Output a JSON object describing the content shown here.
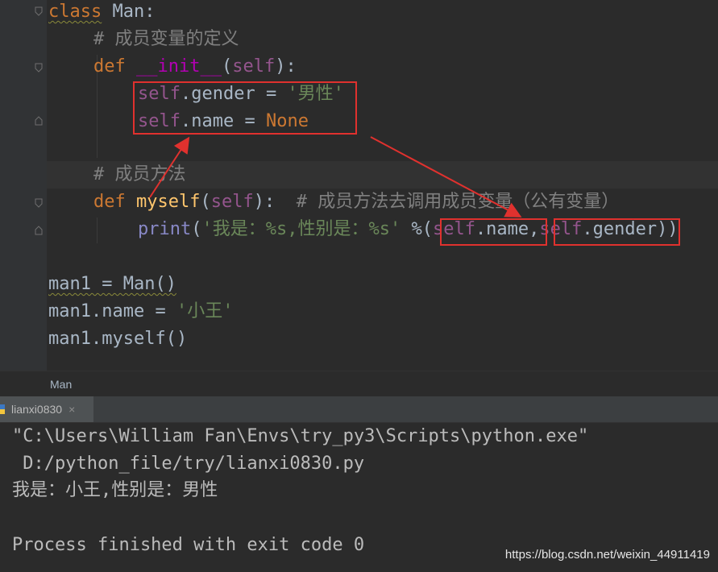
{
  "editor": {
    "lines": {
      "l1": {
        "kw": "class",
        "rest": " Man:"
      },
      "l2": {
        "comment": "# 成员变量的定义"
      },
      "l3": {
        "kw": "def",
        "sp": " ",
        "fn": "__init__",
        "p1": "(",
        "self": "self",
        "p2": "):"
      },
      "l4": {
        "self": "self",
        "rest": ".gender = ",
        "str": "'男性'"
      },
      "l5": {
        "self": "self",
        "rest": ".name = ",
        "kw": "None"
      },
      "l6": {
        "comment": "# 成员方法"
      },
      "l7": {
        "kw": "def",
        "sp": " ",
        "fn": "myself",
        "p1": "(",
        "self": "self",
        "p2": "):",
        "gap": "  ",
        "comment": "# 成员方法去调用成员变量（公有变量）"
      },
      "l8": {
        "fn": "print",
        "p1": "(",
        "str": "'我是：%s,性别是：%s'",
        "op": " %(",
        "self1": "self",
        "a1": ".name",
        "comma": ",",
        "self2": "self",
        "a2": ".gender",
        "end": "))"
      },
      "l9": {
        "text": "man1 = Man()"
      },
      "l10": {
        "pre": "man1.name = ",
        "str": "'小王'"
      },
      "l11": {
        "text": "man1.myself()"
      }
    }
  },
  "breadcrumb": {
    "label": "Man"
  },
  "run_tab": {
    "label": "lianxi0830",
    "close": "×"
  },
  "console": {
    "line1": "\"C:\\Users\\William Fan\\Envs\\try_py3\\Scripts\\python.exe\"",
    "line2": " D:/python_file/try/lianxi0830.py",
    "line3": "我是：小王,性别是：男性",
    "line4": "Process finished with exit code 0"
  },
  "watermark": {
    "text": "https://blog.csdn.net/weixin_44911419"
  },
  "colors": {
    "annotation": "#e0312e",
    "keyword": "#cc7832",
    "self": "#94558d",
    "string": "#6a8759",
    "comment": "#808080"
  }
}
